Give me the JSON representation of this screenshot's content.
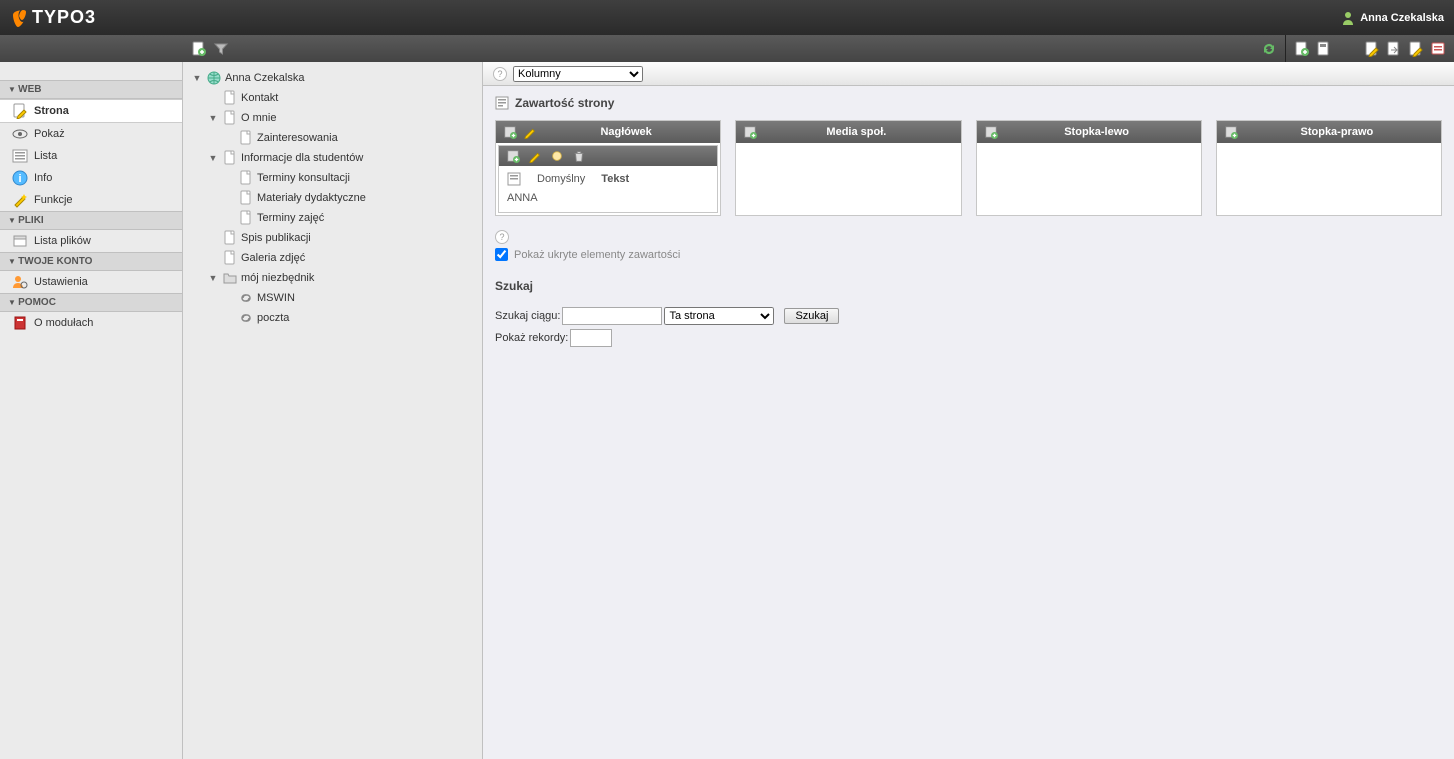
{
  "header": {
    "logo_text": "TYPO3",
    "user_name": "Anna Czekalska"
  },
  "sidebar": {
    "groups": [
      {
        "label": "WEB",
        "items": [
          {
            "label": "Strona",
            "icon": "page-edit",
            "active": true
          },
          {
            "label": "Pokaż",
            "icon": "eye"
          },
          {
            "label": "Lista",
            "icon": "list"
          },
          {
            "label": "Info",
            "icon": "info"
          },
          {
            "label": "Funkcje",
            "icon": "wand"
          }
        ]
      },
      {
        "label": "PLIKI",
        "items": [
          {
            "label": "Lista plików",
            "icon": "filelist"
          }
        ]
      },
      {
        "label": "TWOJE KONTO",
        "items": [
          {
            "label": "Ustawienia",
            "icon": "user-settings"
          }
        ]
      },
      {
        "label": "POMOC",
        "items": [
          {
            "label": "O modułach",
            "icon": "manual"
          }
        ]
      }
    ]
  },
  "tree": [
    {
      "depth": 0,
      "label": "Anna Czekalska",
      "icon": "globe",
      "toggle": "▼"
    },
    {
      "depth": 1,
      "label": "Kontakt",
      "icon": "page",
      "toggle": ""
    },
    {
      "depth": 1,
      "label": "O mnie",
      "icon": "page",
      "toggle": "▼"
    },
    {
      "depth": 2,
      "label": "Zainteresowania",
      "icon": "page",
      "toggle": ""
    },
    {
      "depth": 1,
      "label": "Informacje dla studentów",
      "icon": "page",
      "toggle": "▼"
    },
    {
      "depth": 2,
      "label": "Terminy konsultacji",
      "icon": "page",
      "toggle": ""
    },
    {
      "depth": 2,
      "label": "Materiały dydaktyczne",
      "icon": "page",
      "toggle": ""
    },
    {
      "depth": 2,
      "label": "Terminy zajęć",
      "icon": "page",
      "toggle": ""
    },
    {
      "depth": 1,
      "label": "Spis publikacji",
      "icon": "page",
      "toggle": ""
    },
    {
      "depth": 1,
      "label": "Galeria zdjęć",
      "icon": "page",
      "toggle": ""
    },
    {
      "depth": 1,
      "label": "mój niezbędnik",
      "icon": "folder",
      "toggle": "▼"
    },
    {
      "depth": 2,
      "label": "MSWIN",
      "icon": "link",
      "toggle": ""
    },
    {
      "depth": 2,
      "label": "poczta",
      "icon": "link",
      "toggle": ""
    }
  ],
  "content": {
    "view_selected": "Kolumny",
    "page_content_title": "Zawartość strony",
    "columns": [
      {
        "title": "Nagłówek"
      },
      {
        "title": "Media społ."
      },
      {
        "title": "Stopka-lewo"
      },
      {
        "title": "Stopka-prawo"
      }
    ],
    "element": {
      "meta_default": "Domyślny",
      "meta_type": "Tekst",
      "body": "ANNA&nbsp;"
    },
    "hidden_checkbox_label": "Pokaż ukryte elementy zawartości",
    "search": {
      "title": "Szukaj",
      "search_string_label": "Szukaj ciągu:",
      "scope_selected": "Ta strona",
      "button": "Szukaj",
      "records_label": "Pokaż rekordy:"
    }
  }
}
